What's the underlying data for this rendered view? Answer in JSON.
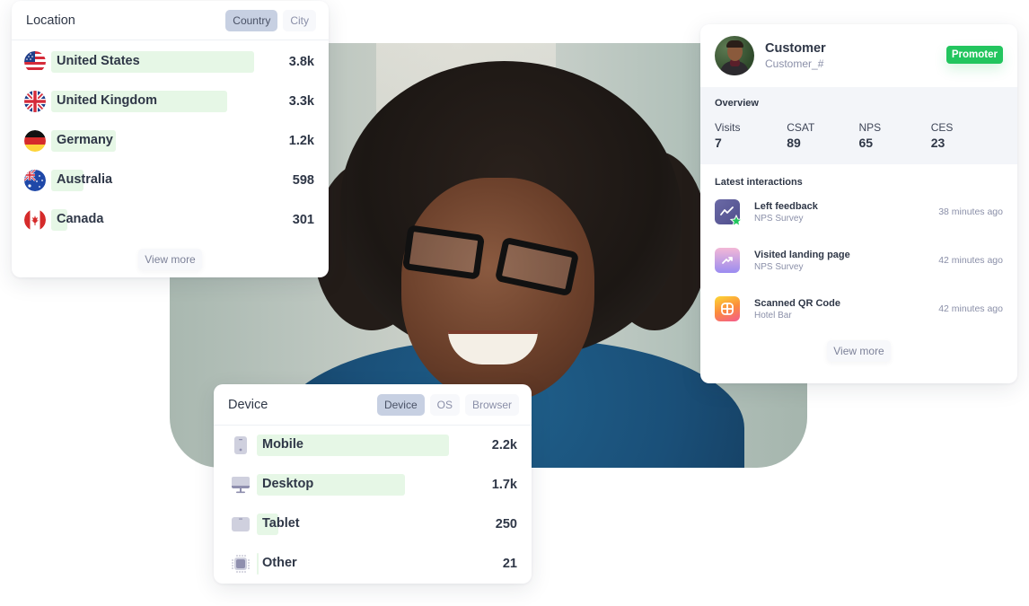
{
  "location": {
    "title": "Location",
    "tabs": [
      {
        "label": "Country",
        "active": true
      },
      {
        "label": "City",
        "active": false
      }
    ],
    "rows": [
      {
        "flag": "us-flag-icon",
        "label": "United States",
        "value": "3.8k",
        "share": 1.0
      },
      {
        "flag": "uk-flag-icon",
        "label": "United Kingdom",
        "value": "3.3k",
        "share": 0.87
      },
      {
        "flag": "germany-flag-icon",
        "label": "Germany",
        "value": "1.2k",
        "share": 0.32
      },
      {
        "flag": "australia-flag-icon",
        "label": "Australia",
        "value": "598",
        "share": 0.16
      },
      {
        "flag": "canada-flag-icon",
        "label": "Canada",
        "value": "301",
        "share": 0.08
      }
    ],
    "view_more": "View more"
  },
  "device": {
    "title": "Device",
    "tabs": [
      {
        "label": "Device",
        "active": true
      },
      {
        "label": "OS",
        "active": false
      },
      {
        "label": "Browser",
        "active": false
      }
    ],
    "rows": [
      {
        "icon": "mobile-icon",
        "label": "Mobile",
        "value": "2.2k",
        "share": 1.0
      },
      {
        "icon": "desktop-icon",
        "label": "Desktop",
        "value": "1.7k",
        "share": 0.77
      },
      {
        "icon": "tablet-icon",
        "label": "Tablet",
        "value": "250",
        "share": 0.11
      },
      {
        "icon": "chip-icon",
        "label": "Other",
        "value": "21",
        "share": 0.01
      }
    ]
  },
  "customer": {
    "name": "Customer",
    "id": "Customer_#",
    "badge": "Promoter",
    "overview_title": "Overview",
    "stats": [
      {
        "label": "Visits",
        "value": "7"
      },
      {
        "label": "CSAT",
        "value": "89"
      },
      {
        "label": "NPS",
        "value": "65"
      },
      {
        "label": "CES",
        "value": "23"
      }
    ],
    "latest_title": "Latest interactions",
    "interactions": [
      {
        "icon": "feedback-chart-star-icon",
        "title": "Left feedback",
        "subtitle": "NPS Survey",
        "time": "38 minutes ago"
      },
      {
        "icon": "trend-up-icon",
        "title": "Visited landing page",
        "subtitle": "NPS Survey",
        "time": "42 minutes ago"
      },
      {
        "icon": "qr-grid-icon",
        "title": "Scanned QR Code",
        "subtitle": "Hotel Bar",
        "time": "42 minutes ago"
      }
    ],
    "view_more": "View more"
  },
  "colors": {
    "bar": "#e6f7e6",
    "active_tab": "#c7d0e2",
    "promoter": "#22c55e",
    "device_icon": "#c9cad9"
  }
}
